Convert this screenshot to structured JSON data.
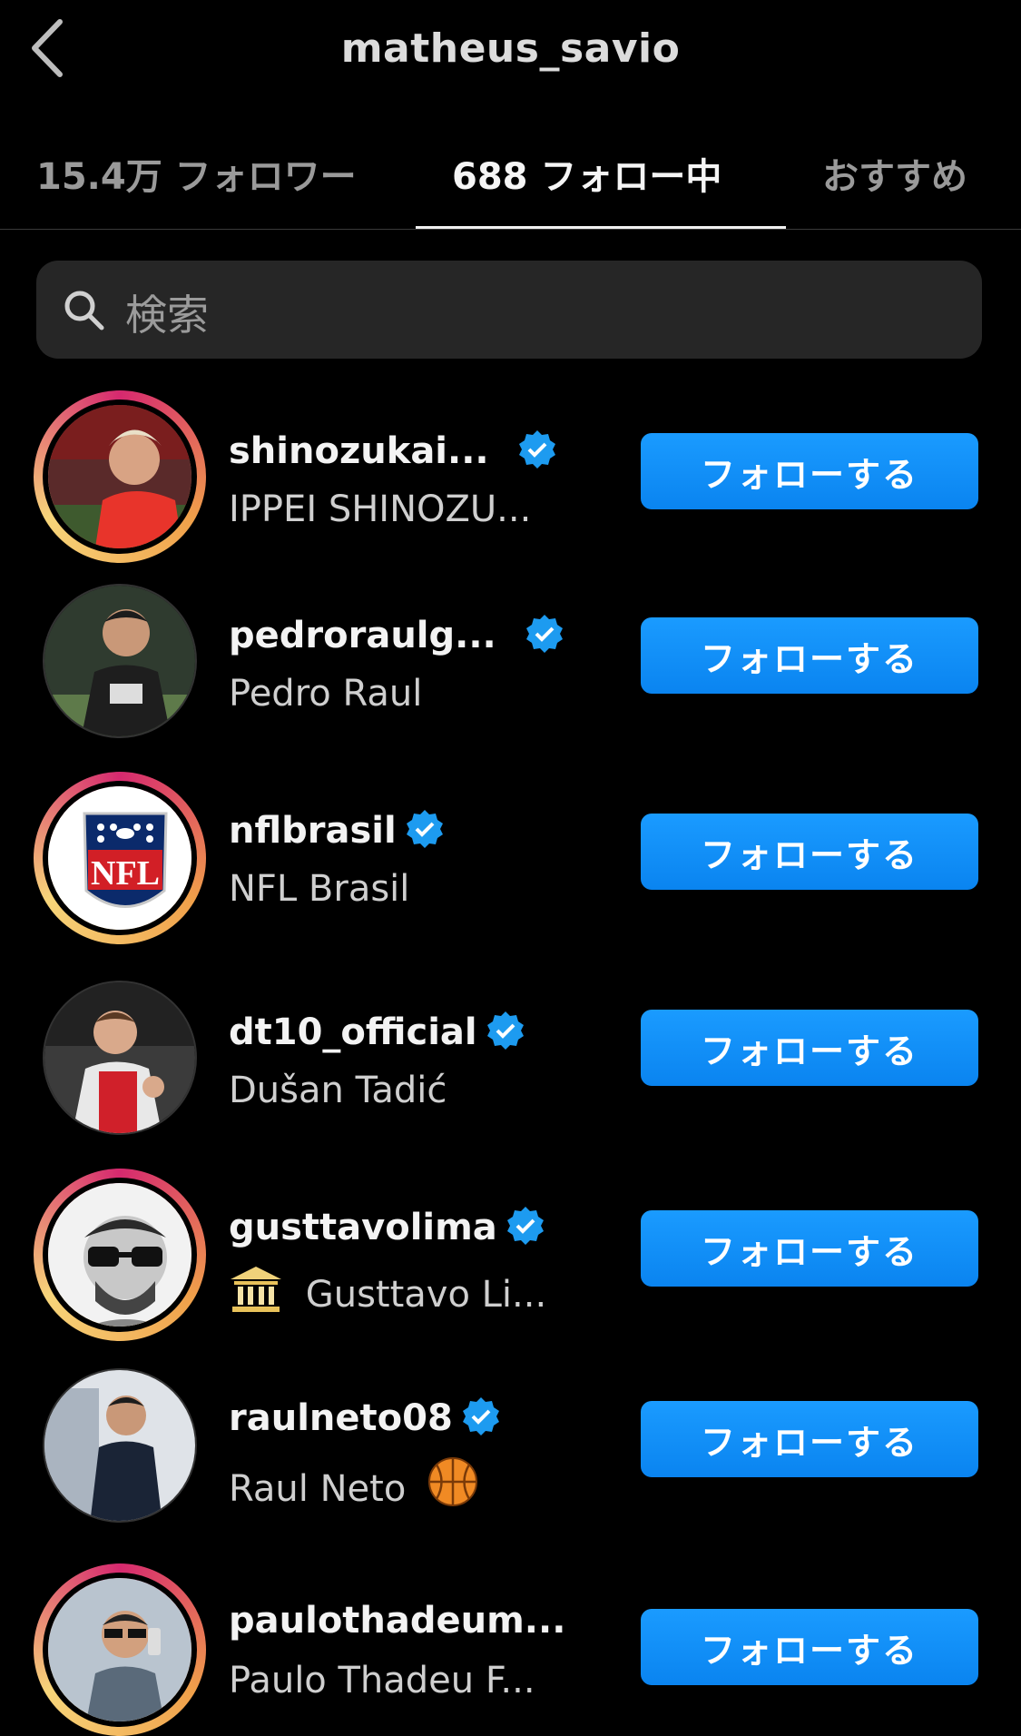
{
  "header": {
    "title": "matheus_savio"
  },
  "tabs": [
    {
      "label": "15.4万 フォロワー"
    },
    {
      "label": "688 フォロー中"
    },
    {
      "label": "おすすめ"
    }
  ],
  "search": {
    "placeholder": "検索"
  },
  "follow_label": "フォローする",
  "accounts": [
    {
      "username": "shinozukai...",
      "fullname": "IPPEI SHINOZU...",
      "verified": true
    },
    {
      "username": "pedroraulg...",
      "fullname": "Pedro Raul",
      "verified": true
    },
    {
      "username": "nflbrasil",
      "fullname": "NFL Brasil",
      "verified": true
    },
    {
      "username": "dt10_official",
      "fullname": "Dušan Tadić",
      "verified": true
    },
    {
      "username": "gusttavolima",
      "fullname": "Gusttavo Li...",
      "verified": true
    },
    {
      "username": "raulneto08",
      "fullname": "Raul Neto",
      "verified": true
    },
    {
      "username": "paulothadeum...",
      "fullname": "Paulo Thadeu F...",
      "verified": false
    }
  ],
  "colors": {
    "background": "#000000",
    "accent": "#0a84f0",
    "verified": "#1d9bf0"
  }
}
